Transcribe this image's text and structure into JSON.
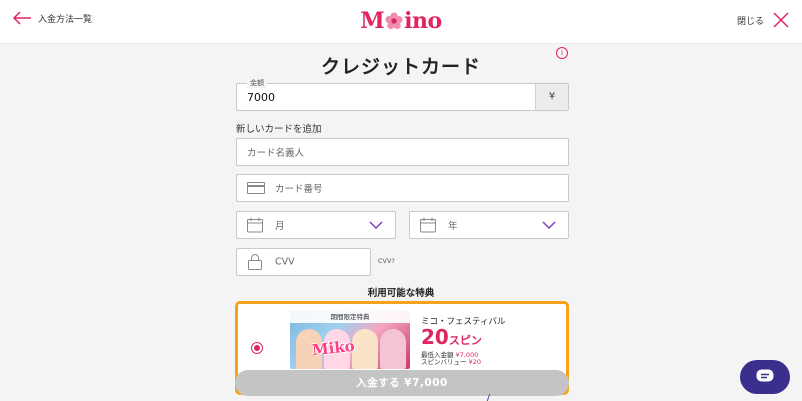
{
  "header": {
    "back_label": "入金方法一覧",
    "logo_letters_left": "M",
    "logo_letters_right": "ino",
    "close_label": "閉じる"
  },
  "page": {
    "title": "クレジットカード",
    "info_badge": "i"
  },
  "amount": {
    "label": "金額",
    "value": "7000",
    "currency": "¥"
  },
  "card_form": {
    "section_label": "新しいカードを追加",
    "holder_placeholder": "カード名義人",
    "number_placeholder": "カード番号",
    "month_placeholder": "月",
    "year_placeholder": "年",
    "cvv_placeholder": "CVV",
    "cvv_hint": "CVV?"
  },
  "bonus": {
    "section_title": "利用可能な特典",
    "selected": true,
    "image_tag": "期間限定特典",
    "name": "ミコ・フェスティバル",
    "spin_count": "20",
    "spin_unit": "スピン",
    "min_deposit_label": "最低入金額",
    "min_deposit_value": "¥7,000",
    "spin_value_label": "スピンバリュー",
    "spin_value_value": "¥20"
  },
  "cta": {
    "deposit_label": "入金する ¥7,000"
  },
  "colors": {
    "brand_pink": "#e0255f",
    "offer_border": "#f6a21b",
    "button_disabled": "#c4c4c4",
    "chat_bg": "#3b2f8e",
    "dropdown_chevron": "#7b3fbf"
  },
  "icons": {
    "back": "arrow-left-icon",
    "close": "close-x-icon",
    "card": "credit-card-icon",
    "calendar": "calendar-icon",
    "lock": "lock-icon",
    "chevron": "chevron-down-icon",
    "chat": "chat-icon"
  }
}
